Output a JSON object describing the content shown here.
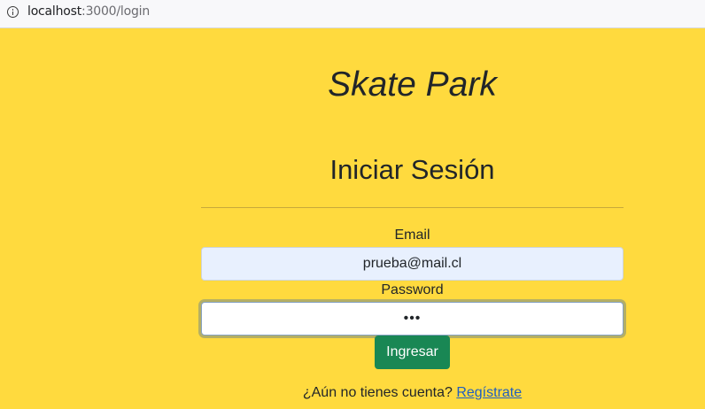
{
  "browser": {
    "url_host": "localhost",
    "url_rest": ":3000/login"
  },
  "header": {
    "site_title": "Skate Park"
  },
  "login_form": {
    "heading": "Iniciar Sesión",
    "email_label": "Email",
    "email_value": "prueba@mail.cl",
    "password_label": "Password",
    "password_value": "abc",
    "submit_label": "Ingresar",
    "register_prompt": "¿Aún no tienes cuenta?",
    "register_link": "Regístrate"
  },
  "colors": {
    "page_background": "#ffda3e",
    "submit_button": "#198754",
    "link": "#1f5fbf"
  },
  "icons": {
    "site_info": "info-icon"
  }
}
